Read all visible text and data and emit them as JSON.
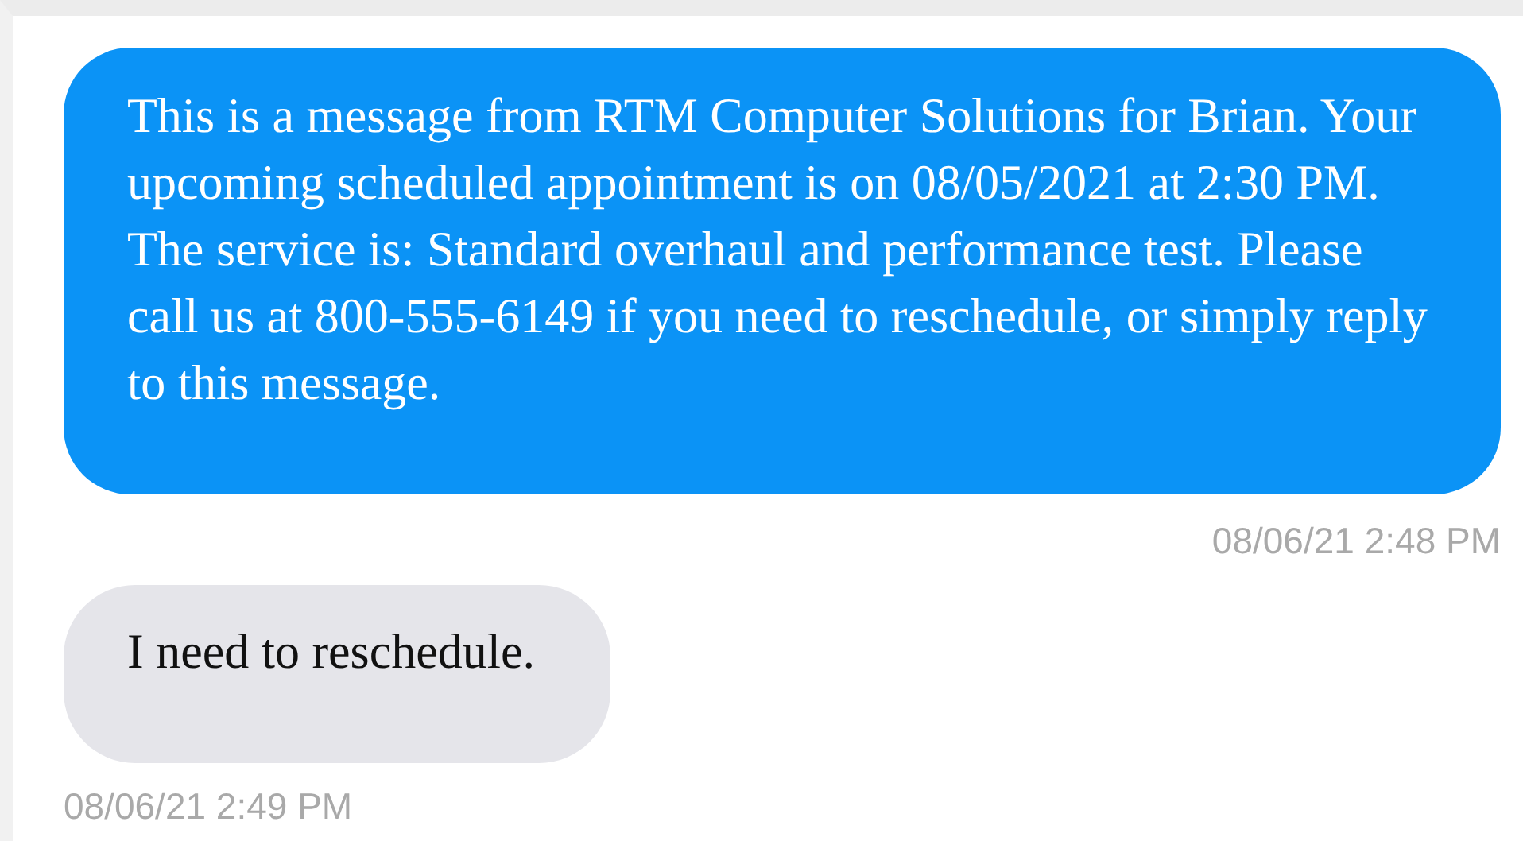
{
  "messages": [
    {
      "kind": "outgoing",
      "text": "This is a message from RTM Computer Solutions for Brian. Your upcoming scheduled appointment is on 08/05/2021 at 2:30 PM. The service is: Standard overhaul and performance test. Please call us at 800-555-6149 if you need to reschedule, or simply reply to this message.",
      "time": "08/06/21 2:48 PM"
    },
    {
      "kind": "incoming",
      "text": "I need to reschedule.",
      "time": "08/06/21 2:49 PM"
    }
  ]
}
